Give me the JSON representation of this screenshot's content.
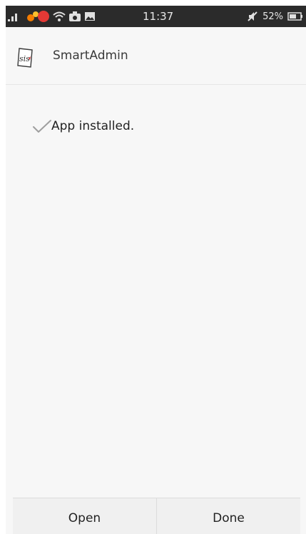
{
  "status_bar": {
    "time": "11:37",
    "battery": "52%",
    "icons": [
      "signal-icon",
      "notification-badge-icon",
      "wifi-icon",
      "camera-icon",
      "gallery-icon",
      "mute-icon",
      "battery-icon"
    ]
  },
  "app": {
    "name": "SmartAdmin",
    "logo_text": "sis",
    "logo_accent": "#d32f2f"
  },
  "install": {
    "status_text": "App installed.",
    "check_color": "#9e9e9e"
  },
  "buttons": {
    "open_label": "Open",
    "done_label": "Done"
  }
}
